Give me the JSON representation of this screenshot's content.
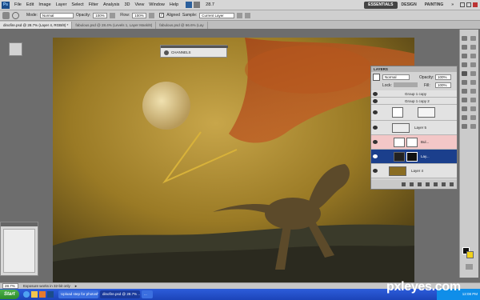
{
  "menu": [
    "File",
    "Edit",
    "Image",
    "Layer",
    "Select",
    "Filter",
    "Analysis",
    "3D",
    "View",
    "Window",
    "Help"
  ],
  "zoom_menu": "28.7",
  "workspaces": [
    "ESSENTIALS",
    "DESIGN",
    "PAINTING"
  ],
  "options": {
    "mode_label": "Mode:",
    "mode_value": "Normal",
    "opacity_label": "Opacity:",
    "opacity_value": "100%",
    "flow_label": "Flow:",
    "flow_value": "100%",
    "aligned_label": "Aligned",
    "sample_label": "Sample:",
    "sample_value": "Current Layer"
  },
  "tabs": [
    "dinofire.psd @ 28.7% (Layer 4, RGB/8) *",
    "fabulous.psd @ 28.4% (Levels 1, Layer Mask/8)",
    "fabulous.psd @ 66.6% (Lay"
  ],
  "channels_panel": {
    "label": "CHANNELS"
  },
  "layers_panel": {
    "tab": "LAYERS",
    "blend": "Normal",
    "opacity_label": "Opacity:",
    "opacity_value": "100%",
    "lock_label": "Lock:",
    "fill_label": "Fill:",
    "fill_value": "100%",
    "rows": [
      "Group 1 copy",
      "Group 1 copy 2",
      "Layer 5",
      "Bul...",
      "Lay...",
      "Layer 4"
    ]
  },
  "status": {
    "zoom": "28.7%",
    "message": "Exposure works in 32-bit only"
  },
  "taskbar": {
    "start": "Start",
    "items": [
      "Upload step for photosh...",
      "dinofire.psd @ 28.7% ...",
      "..."
    ],
    "clock": "12:08 PM"
  },
  "watermark": "pxleyes.com"
}
